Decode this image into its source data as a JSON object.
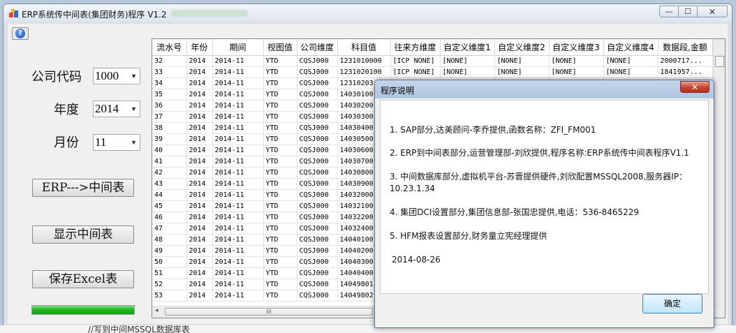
{
  "window": {
    "title": "ERP系统传中间表(集团财务)程序 V1.2",
    "min": "—",
    "max": "☐",
    "close": "✕"
  },
  "form": {
    "help_icon": "help-icon",
    "company_label": "公司代码",
    "company_value": "1000",
    "year_label": "年度",
    "year_value": "2014",
    "month_label": "月份",
    "month_value": "11",
    "btn_erp": "ERP--->中间表",
    "btn_show": "显示中间表",
    "btn_excel": "保存Excel表",
    "progress": 1.0
  },
  "grid": {
    "columns": [
      "流水号",
      "年份",
      "期间",
      "视图值",
      "公司维度",
      "科目值",
      "往来方维度",
      "自定义维度1",
      "自定义维度2",
      "自定义维度3",
      "自定义维度4",
      "数据段,金额"
    ],
    "rows": [
      [
        "32",
        "2014",
        "2014-11",
        "YTD",
        "CQSJ000",
        "1231010000",
        "[ICP NONE]",
        "[NONE]",
        "[NONE]",
        "[NONE]",
        "[NONE]",
        "2000717..."
      ],
      [
        "33",
        "2014",
        "2014-11",
        "YTD",
        "CQSJ000",
        "1231020100",
        "[ICP NONE]",
        "[NONE]",
        "[NONE]",
        "[NONE]",
        "[NONE]",
        "1841957..."
      ],
      [
        "34",
        "2014",
        "2014-11",
        "YTD",
        "CQSJ000",
        "12310203",
        "",
        "",
        "",
        "",
        "",
        ""
      ],
      [
        "35",
        "2014",
        "2014-11",
        "YTD",
        "CQSJ000",
        "14030100",
        "",
        "",
        "",
        "",
        "",
        ""
      ],
      [
        "36",
        "2014",
        "2014-11",
        "YTD",
        "CQSJ000",
        "14030200",
        "",
        "",
        "",
        "",
        "",
        ""
      ],
      [
        "37",
        "2014",
        "2014-11",
        "YTD",
        "CQSJ000",
        "14030300",
        "",
        "",
        "",
        "",
        "",
        ""
      ],
      [
        "38",
        "2014",
        "2014-11",
        "YTD",
        "CQSJ000",
        "14030400",
        "",
        "",
        "",
        "",
        "",
        ""
      ],
      [
        "39",
        "2014",
        "2014-11",
        "YTD",
        "CQSJ000",
        "14030500",
        "",
        "",
        "",
        "",
        "",
        ""
      ],
      [
        "40",
        "2014",
        "2014-11",
        "YTD",
        "CQSJ000",
        "14030600",
        "",
        "",
        "",
        "",
        "",
        ""
      ],
      [
        "41",
        "2014",
        "2014-11",
        "YTD",
        "CQSJ000",
        "14030700",
        "",
        "",
        "",
        "",
        "",
        ""
      ],
      [
        "42",
        "2014",
        "2014-11",
        "YTD",
        "CQSJ000",
        "14030800",
        "",
        "",
        "",
        "",
        "",
        ""
      ],
      [
        "43",
        "2014",
        "2014-11",
        "YTD",
        "CQSJ000",
        "14030900",
        "",
        "",
        "",
        "",
        "",
        ""
      ],
      [
        "44",
        "2014",
        "2014-11",
        "YTD",
        "CQSJ000",
        "14032000",
        "",
        "",
        "",
        "",
        "",
        ""
      ],
      [
        "45",
        "2014",
        "2014-11",
        "YTD",
        "CQSJ000",
        "14032100",
        "",
        "",
        "",
        "",
        "",
        ""
      ],
      [
        "46",
        "2014",
        "2014-11",
        "YTD",
        "CQSJ000",
        "14032200",
        "",
        "",
        "",
        "",
        "",
        ""
      ],
      [
        "47",
        "2014",
        "2014-11",
        "YTD",
        "CQSJ000",
        "14032400",
        "",
        "",
        "",
        "",
        "",
        ""
      ],
      [
        "48",
        "2014",
        "2014-11",
        "YTD",
        "CQSJ000",
        "14040100",
        "",
        "",
        "",
        "",
        "",
        ""
      ],
      [
        "49",
        "2014",
        "2014-11",
        "YTD",
        "CQSJ000",
        "14040200",
        "",
        "",
        "",
        "",
        "",
        ""
      ],
      [
        "50",
        "2014",
        "2014-11",
        "YTD",
        "CQSJ000",
        "14040300",
        "",
        "",
        "",
        "",
        "",
        ""
      ],
      [
        "51",
        "2014",
        "2014-11",
        "YTD",
        "CQSJ000",
        "14040400",
        "",
        "",
        "",
        "",
        "",
        ""
      ],
      [
        "52",
        "2014",
        "2014-11",
        "YTD",
        "CQSJ000",
        "14049801",
        "",
        "",
        "",
        "",
        "",
        ""
      ],
      [
        "53",
        "2014",
        "2014-11",
        "YTD",
        "CQSJ000",
        "14049802",
        "",
        "",
        "",
        "",
        "",
        ""
      ]
    ],
    "hscroll_grip": "III"
  },
  "dialog": {
    "title": "程序说明",
    "close": "✕",
    "lines": [
      "1. SAP部分,达美顾问-李乔提供,函数名称：ZFI_FM001",
      "2. ERP到中间表部分,运营管理部-刘欣提供,程序名称:ERP系统传中间表程序V1.1",
      "3. 中间数据库部分,虚拟机平台-苏晋提供硬件,刘欣配置MSSQL2008,服务器IP：10.23.1.34",
      "4. 集团DCI设置部分,集团信息部-张国忠提供,电话：536-8465229",
      "5. HFM报表设置部分,财务童立宪经理提供",
      "2014-08-26"
    ],
    "ok": "确定"
  },
  "background_text": "//写到中间MSSQL数据库表"
}
